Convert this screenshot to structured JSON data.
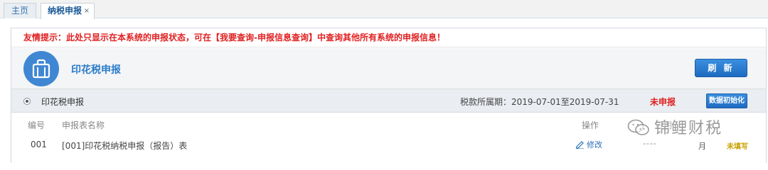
{
  "tabs": {
    "home_label": "主页",
    "active_label": "纳税申报",
    "close_glyph": "×"
  },
  "notice": "友情提示：此处只显示在本系统的申报状态，可在【我要查询-申报信息查询】中查询其他所有系统的申报信息！",
  "hero": {
    "icon": "briefcase-icon",
    "title": "印花税申报",
    "refresh_label": "刷 新"
  },
  "bar": {
    "title": "印花税申报",
    "period": "税款所属期：2019-07-01至2019-07-31",
    "status": "未申报",
    "init_label": "数据初始化"
  },
  "table": {
    "headers": [
      "编号",
      "申报表名称",
      "操作",
      "日期"
    ],
    "rows": [
      {
        "no": "001",
        "name": "[001]印花税纳税申报（报告）表",
        "action": "修改",
        "date": "----",
        "month": "月",
        "state": "未填写"
      }
    ]
  },
  "watermark": "锦鲤财税",
  "colors": {
    "accent_blue": "#2b7cc9",
    "warning_red": "#e02020",
    "unfilled_yellow": "#c9a000"
  }
}
